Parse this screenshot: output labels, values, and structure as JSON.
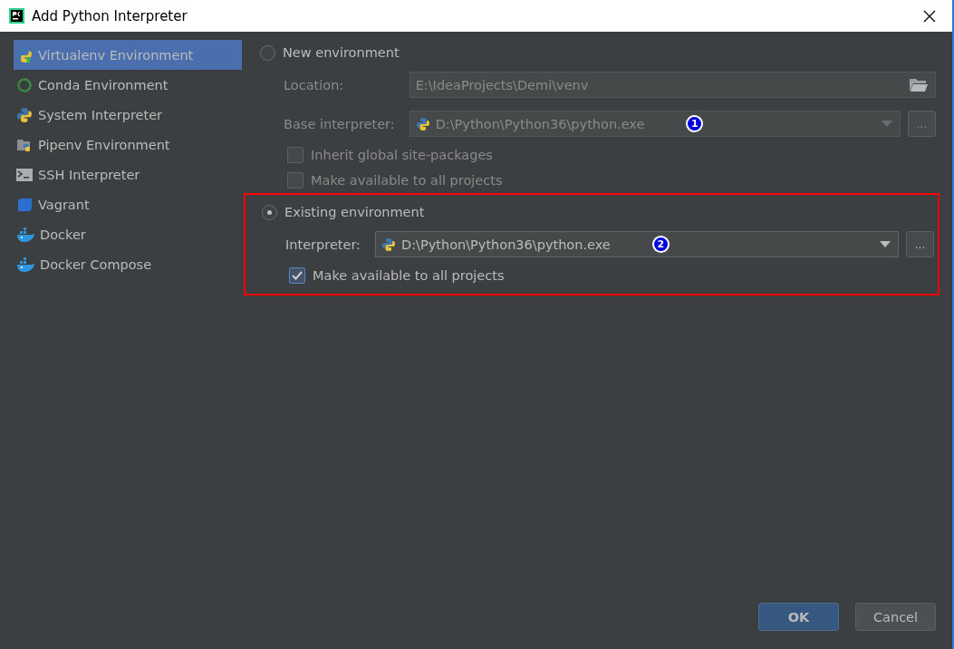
{
  "window": {
    "title": "Add Python Interpreter"
  },
  "sidebar": {
    "items": [
      {
        "label": "Virtualenv Environment",
        "kind": "virtualenv",
        "selected": true
      },
      {
        "label": "Conda Environment",
        "kind": "conda",
        "selected": false
      },
      {
        "label": "System Interpreter",
        "kind": "python",
        "selected": false
      },
      {
        "label": "Pipenv Environment",
        "kind": "pipenv",
        "selected": false
      },
      {
        "label": "SSH Interpreter",
        "kind": "terminal",
        "selected": false
      },
      {
        "label": "Vagrant",
        "kind": "vagrant",
        "selected": false
      },
      {
        "label": "Docker",
        "kind": "docker",
        "selected": false
      },
      {
        "label": "Docker Compose",
        "kind": "docker",
        "selected": false
      }
    ]
  },
  "environments": [
    {
      "label": "New environment",
      "selected": false,
      "disabled": true,
      "highlighted": false,
      "fields": [
        {
          "kind": "path",
          "label": "Location:",
          "value": "E:\\IdeaProjects\\Demi\\venv"
        },
        {
          "kind": "select",
          "label": "Base interpreter:",
          "value": "D:\\Python\\Python36\\python.exe",
          "marker": "1",
          "browse": "..."
        }
      ],
      "options": [
        {
          "label": "Inherit global site-packages",
          "checked": false
        },
        {
          "label": "Make available to all projects",
          "checked": false
        }
      ]
    },
    {
      "label": "Existing environment",
      "selected": true,
      "disabled": false,
      "highlighted": true,
      "fields": [
        {
          "kind": "select",
          "label": "Interpreter:",
          "value": "D:\\Python\\Python36\\python.exe",
          "marker": "2",
          "browse": "..."
        }
      ],
      "options": [
        {
          "label": "Make available to all projects",
          "checked": true
        }
      ]
    }
  ],
  "buttons": [
    {
      "label": "OK",
      "kind": "primary"
    },
    {
      "label": "Cancel",
      "kind": "secondary"
    }
  ]
}
